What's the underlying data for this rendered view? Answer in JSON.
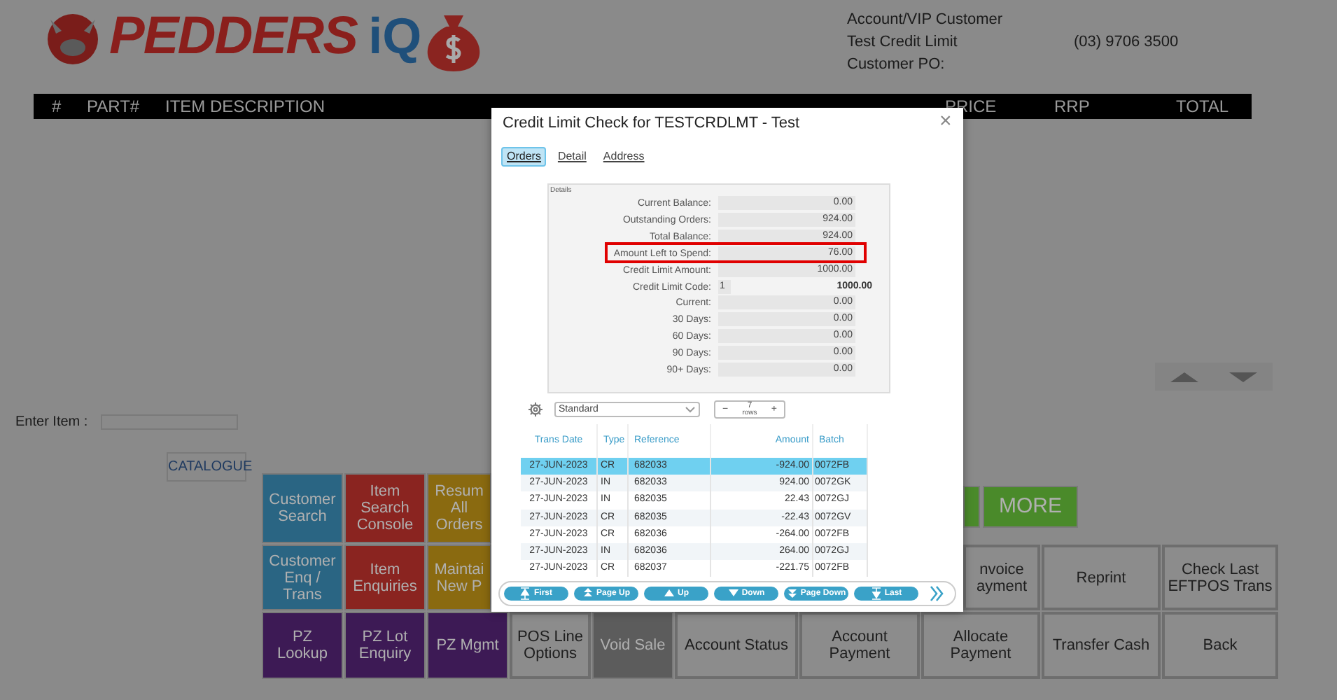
{
  "customer": {
    "lines": [
      "Account/VIP Customer",
      "Test Credit Limit",
      "Customer PO:"
    ],
    "phone": "(03) 9706 3500"
  },
  "logo": {
    "brand": "PEDDERS",
    "suffix": "iQ"
  },
  "order_header": {
    "columns": [
      "#",
      "PART#",
      "ITEM DESCRIPTION",
      "PRICE",
      "RRP",
      "TOTAL"
    ]
  },
  "enter_item": {
    "label": "Enter Item :"
  },
  "catalogue_button": "CATALOGUE",
  "button_rows": [
    [
      {
        "label": "Customer Search",
        "color": "#2a6583"
      },
      {
        "label": "Item Search Console",
        "color": "#8a2420"
      },
      {
        "label": "Resum All Orders",
        "color": "#8a6a10"
      },
      {
        "color": "#4a8a2a"
      },
      {
        "label": "MORE",
        "color": "#4a8a2a"
      }
    ],
    [
      {
        "label": "Customer Enq / Trans",
        "color": "#2a6583"
      },
      {
        "label": "Item Enquiries",
        "color": "#8a2420"
      },
      {
        "label": "Maintai New P",
        "color": "#8a6a10"
      },
      {
        "label": "nvoice ayment",
        "color": "#8c8c8c"
      },
      {
        "label": "Reprint",
        "color": "#8c8c8c"
      },
      {
        "label": "Check Last EFTPOS Trans",
        "color": "#8c8c8c"
      }
    ],
    [
      {
        "label": "PZ Lookup",
        "color": "#3d1a55"
      },
      {
        "label": "PZ Lot Enquiry",
        "color": "#3d1a55"
      },
      {
        "label": "PZ Mgmt",
        "color": "#3d1a55"
      },
      {
        "label": "POS Line Options",
        "color": "#8c8c8c"
      },
      {
        "label": "Void Sale",
        "color": "#5c5c5c"
      },
      {
        "label": "Account Status",
        "color": "#8c8c8c"
      },
      {
        "label": "Account Payment",
        "color": "#8c8c8c"
      },
      {
        "label": "Allocate Payment",
        "color": "#8c8c8c"
      },
      {
        "label": "Transfer Cash",
        "color": "#8c8c8c"
      },
      {
        "label": "Back",
        "color": "#8c8c8c"
      }
    ]
  ],
  "dialog": {
    "title": "Credit Limit Check for TESTCRDLMT - Test",
    "close": "×",
    "tabs": [
      {
        "label": "Orders",
        "selected": true
      },
      {
        "label": "Detail",
        "selected": false
      },
      {
        "label": "Address",
        "selected": false
      }
    ],
    "details": {
      "title": "Details",
      "rows": [
        {
          "kind": "field",
          "label": "Current Balance:",
          "value": "0.00",
          "highlighted": false
        },
        {
          "kind": "field",
          "label": "Outstanding Orders:",
          "value": "924.00",
          "highlighted": false
        },
        {
          "kind": "field",
          "label": "Total Balance:",
          "value": "924.00",
          "highlighted": false
        },
        {
          "kind": "field",
          "label": "Amount Left to Spend:",
          "value": "76.00",
          "highlighted": true
        },
        {
          "kind": "field",
          "label": "Credit Limit Amount:",
          "value": "1000.00",
          "highlighted": false
        },
        {
          "kind": "code",
          "label": "Credit Limit Code:",
          "code": "1",
          "value": "1000.00",
          "highlighted": false
        },
        {
          "kind": "field",
          "label": "Current:",
          "value": "0.00",
          "highlighted": false
        },
        {
          "kind": "field",
          "label": "30 Days:",
          "value": "0.00",
          "highlighted": false
        },
        {
          "kind": "field",
          "label": "60 Days:",
          "value": "0.00",
          "highlighted": false
        },
        {
          "kind": "field",
          "label": "90 Days:",
          "value": "0.00",
          "highlighted": false
        },
        {
          "kind": "field",
          "label": "90+ Days:",
          "value": "0.00",
          "highlighted": false
        }
      ]
    },
    "view_select": "Standard",
    "rows_control": {
      "minus": "−",
      "count": "7",
      "unit": "rows",
      "plus": "+"
    },
    "table": {
      "columns": [
        "Trans Date",
        "Type",
        "Reference",
        "Amount",
        "Batch"
      ],
      "rows": [
        {
          "cells": [
            "27-JUN-2023",
            "CR",
            "682033",
            "-924.00",
            "0072FB"
          ],
          "selected": true
        },
        {
          "cells": [
            "27-JUN-2023",
            "IN",
            "682033",
            "924.00",
            "0072GK"
          ],
          "selected": false
        },
        {
          "cells": [
            "27-JUN-2023",
            "IN",
            "682035",
            "22.43",
            "0072GJ"
          ],
          "selected": false
        },
        {
          "cells": [
            "27-JUN-2023",
            "CR",
            "682035",
            "-22.43",
            "0072GV"
          ],
          "selected": false
        },
        {
          "cells": [
            "27-JUN-2023",
            "CR",
            "682036",
            "-264.00",
            "0072FB"
          ],
          "selected": false
        },
        {
          "cells": [
            "27-JUN-2023",
            "IN",
            "682036",
            "264.00",
            "0072GJ"
          ],
          "selected": false
        },
        {
          "cells": [
            "27-JUN-2023",
            "CR",
            "682037",
            "-221.75",
            "0072FB"
          ],
          "selected": false
        }
      ]
    },
    "nav_buttons": [
      {
        "label": "First",
        "kind": "first"
      },
      {
        "label": "Page Up",
        "kind": "pageup"
      },
      {
        "label": "Up",
        "kind": "up"
      },
      {
        "label": "Down",
        "kind": "down"
      },
      {
        "label": "Page Down",
        "kind": "pagedown"
      },
      {
        "label": "Last",
        "kind": "last"
      }
    ]
  }
}
